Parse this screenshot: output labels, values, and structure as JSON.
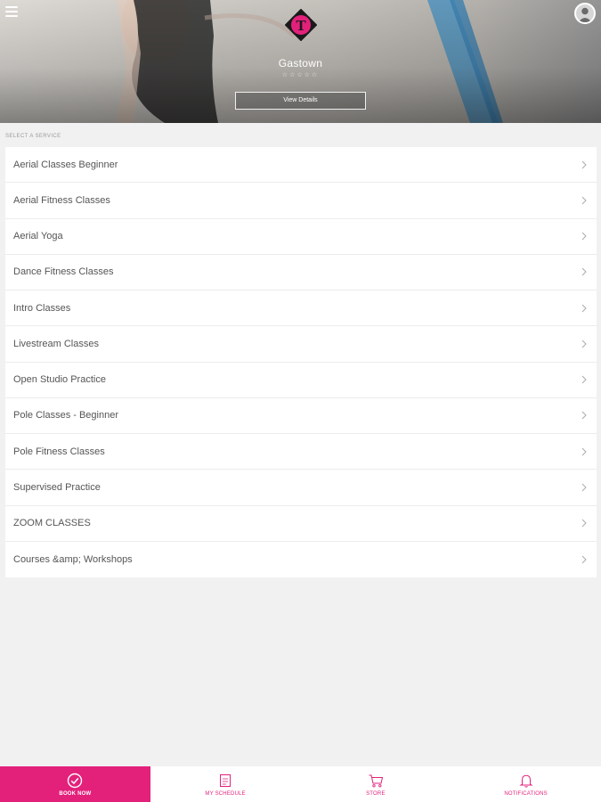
{
  "header": {
    "studio_name": "Gastown",
    "rating_stars": "☆☆☆☆☆",
    "view_details_label": "View Details",
    "logo_letter": "T"
  },
  "section": {
    "label": "SELECT A SERVICE"
  },
  "services": [
    {
      "label": "Aerial Classes Beginner"
    },
    {
      "label": "Aerial Fitness Classes"
    },
    {
      "label": "Aerial Yoga"
    },
    {
      "label": "Dance Fitness Classes"
    },
    {
      "label": "Intro Classes"
    },
    {
      "label": "Livestream Classes"
    },
    {
      "label": "Open Studio Practice"
    },
    {
      "label": "Pole Classes - Beginner"
    },
    {
      "label": "Pole Fitness Classes"
    },
    {
      "label": "Supervised Practice"
    },
    {
      "label": "ZOOM CLASSES"
    },
    {
      "label": "Courses &amp; Workshops"
    }
  ],
  "nav": {
    "tabs": [
      {
        "label": "BOOK NOW",
        "icon": "check-circle-icon",
        "active": true
      },
      {
        "label": "MY SCHEDULE",
        "icon": "calendar-icon",
        "active": false
      },
      {
        "label": "STORE",
        "icon": "cart-icon",
        "active": false
      },
      {
        "label": "NOTIFICATIONS",
        "icon": "bell-icon",
        "active": false
      }
    ]
  },
  "colors": {
    "accent": "#e3217b",
    "background": "#f1f1f1"
  }
}
